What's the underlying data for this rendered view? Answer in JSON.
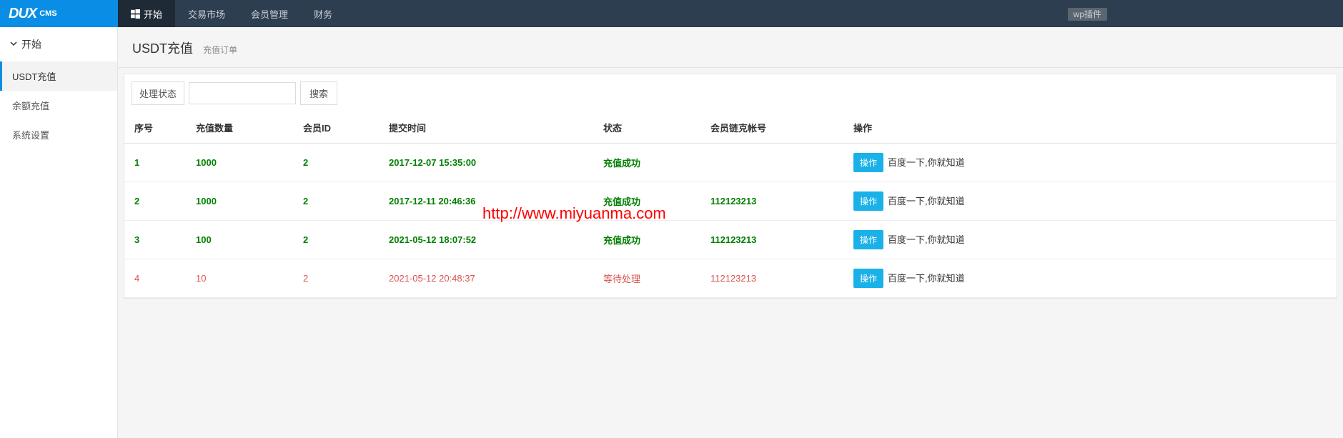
{
  "brand": {
    "big": "DUX",
    "small": "CMS"
  },
  "top_nav": {
    "items": [
      {
        "label": "开始",
        "icon": "windows"
      },
      {
        "label": "交易市场"
      },
      {
        "label": "会员管理"
      },
      {
        "label": "财务"
      }
    ],
    "wp_badge": "wp插件"
  },
  "sidebar": {
    "header": "开始",
    "items": [
      {
        "label": "USDT充值"
      },
      {
        "label": "余额充值"
      },
      {
        "label": "系统设置"
      }
    ]
  },
  "page": {
    "title": "USDT充值",
    "subtitle": "充值订单"
  },
  "filter": {
    "label": "处理状态",
    "search_btn": "搜索",
    "value": ""
  },
  "table": {
    "headers": {
      "seq": "序号",
      "amount": "充值数量",
      "member_id": "会员ID",
      "submit_time": "提交时间",
      "status": "状态",
      "chain_account": "会员链克帐号",
      "ops": "操作"
    },
    "rows": [
      {
        "seq": "1",
        "amount": "1000",
        "member_id": "2",
        "submit_time": "2017-12-07 15:35:00",
        "status": "充值成功",
        "chain_account": "",
        "status_class": "success"
      },
      {
        "seq": "2",
        "amount": "1000",
        "member_id": "2",
        "submit_time": "2017-12-11 20:46:36",
        "status": "充值成功",
        "chain_account": "112123213",
        "status_class": "success"
      },
      {
        "seq": "3",
        "amount": "100",
        "member_id": "2",
        "submit_time": "2021-05-12 18:07:52",
        "status": "充值成功",
        "chain_account": "112123213",
        "status_class": "success"
      },
      {
        "seq": "4",
        "amount": "10",
        "member_id": "2",
        "submit_time": "2021-05-12 20:48:37",
        "status": "等待处理",
        "chain_account": "112123213",
        "status_class": "pending"
      }
    ],
    "op_btn": "操作",
    "op_link": "百度一下,你就知道"
  },
  "watermark": "http://www.miyuanma.com"
}
